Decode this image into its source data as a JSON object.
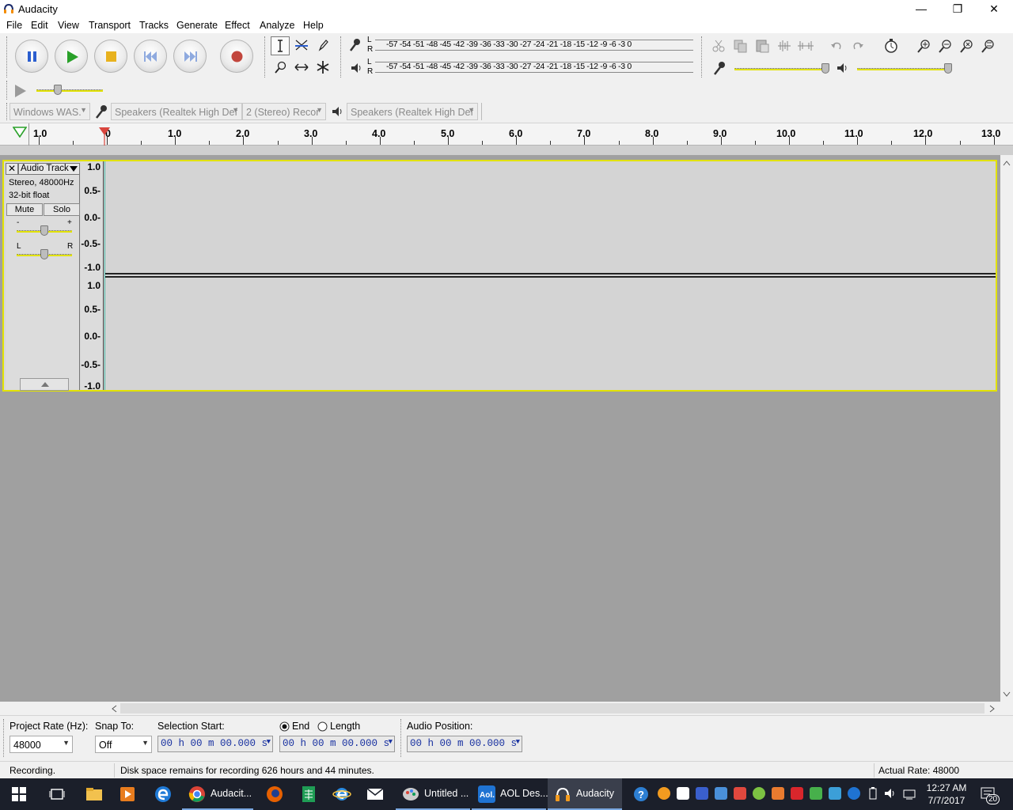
{
  "window": {
    "title": "Audacity",
    "minimize": "—",
    "maximize": "❐",
    "close": "✕"
  },
  "menu": [
    "File",
    "Edit",
    "View",
    "Transport",
    "Tracks",
    "Generate",
    "Effect",
    "Analyze",
    "Help"
  ],
  "meters": {
    "record_scale": "-57 -54 -51 -48 -45 -42 -39 -36 -33 -30 -27 -24 -21 -18 -15 -12  -9  -6  -3  0",
    "play_scale": "-57 -54 -51 -48 -45 -42 -39 -36 -33 -30 -27 -24 -21 -18 -15 -12  -9  -6  -3  0",
    "left_label": "L",
    "right_label": "R"
  },
  "device_toolbar": {
    "host": "Windows WAS.",
    "recording_device": "Speakers (Realtek High Def",
    "channels": "2 (Stereo) Recor",
    "playback_device": "Speakers (Realtek High Def"
  },
  "ruler": {
    "labels": [
      "1.0",
      "0",
      "1.0",
      "2.0",
      "3.0",
      "4.0",
      "5.0",
      "6.0",
      "7.0",
      "8.0",
      "9.0",
      "10.0",
      "11.0",
      "12.0",
      "13.0"
    ]
  },
  "track": {
    "name": "Audio Track",
    "info1": "Stereo, 48000Hz",
    "info2": "32-bit float",
    "mute": "Mute",
    "solo": "Solo",
    "gain_minus": "-",
    "gain_plus": "+",
    "pan_left": "L",
    "pan_right": "R",
    "scale_top": [
      "1.0",
      "0.5-",
      "0.0-",
      "-0.5-",
      "-1.0"
    ],
    "scale_bottom": [
      "1.0",
      "0.5-",
      "0.0-",
      "-0.5-",
      "-1.0"
    ]
  },
  "selection_toolbar": {
    "project_rate_label": "Project Rate (Hz):",
    "project_rate": "48000",
    "snap_to_label": "Snap To:",
    "snap_to": "Off",
    "selection_start_label": "Selection Start:",
    "end_label": "End",
    "length_label": "Length",
    "audio_position_label": "Audio Position:",
    "time_value": "00 h 00 m 00.000 s"
  },
  "status": {
    "state": "Recording.",
    "message": "Disk space remains for recording 626 hours and 44 minutes.",
    "actual_rate": "Actual Rate: 48000"
  },
  "taskbar": {
    "apps": [
      {
        "label": "Audacit...",
        "color": "#db4437"
      },
      {
        "label": "Untitled ...",
        "color": "#8a8a8a"
      },
      {
        "label": "AOL Des...",
        "color": "#1f73d2"
      },
      {
        "label": "Audacity",
        "color": "#f29b1f"
      }
    ],
    "time": "12:27 AM",
    "date": "7/7/2017",
    "notification_count": "20"
  }
}
